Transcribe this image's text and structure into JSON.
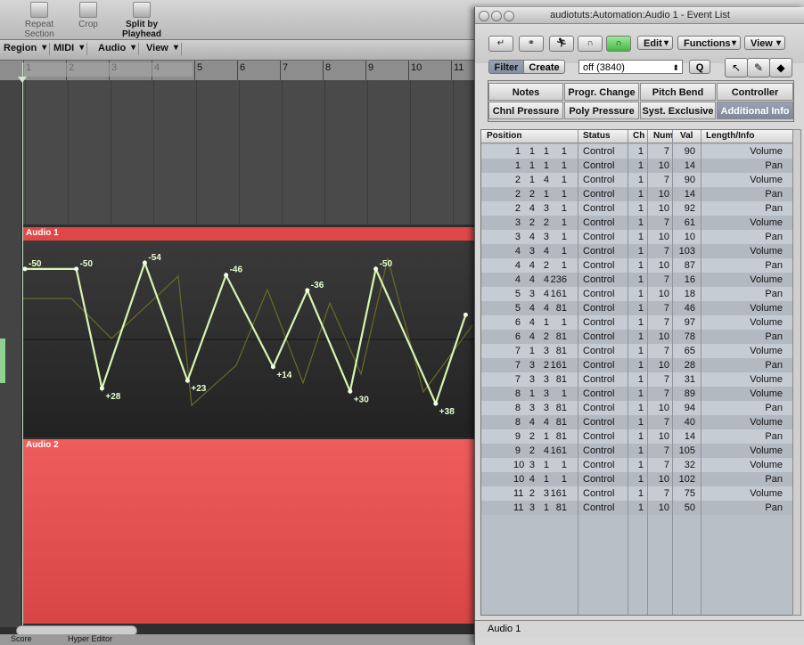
{
  "toolbar": {
    "repeat_section": "Repeat Section",
    "crop": "Crop",
    "split_by_playhead": "Split by Playhead"
  },
  "arrange_menu": [
    "Region",
    "MIDI",
    "Audio",
    "View"
  ],
  "ruler": [
    "1",
    "2",
    "3",
    "4",
    "5",
    "6",
    "7",
    "8",
    "9",
    "10",
    "11"
  ],
  "tracks": {
    "audio1": "Audio 1",
    "audio2": "Audio 2"
  },
  "automation": {
    "points": [
      {
        "time": 1.0,
        "value": -50
      },
      {
        "time": 2.2,
        "value": -50
      },
      {
        "time": 2.8,
        "value": 28
      },
      {
        "time": 3.8,
        "value": -54
      },
      {
        "time": 4.8,
        "value": 23
      },
      {
        "time": 5.7,
        "value": -46
      },
      {
        "time": 6.8,
        "value": 14
      },
      {
        "time": 7.6,
        "value": -36
      },
      {
        "time": 8.6,
        "value": 30
      },
      {
        "time": 9.2,
        "value": -50
      },
      {
        "time": 10.6,
        "value": 38
      },
      {
        "time": 11.3,
        "value": -20
      }
    ],
    "labels": [
      "-50",
      "-50",
      "+28",
      "-54",
      "+23",
      "-46",
      "+14",
      "-36",
      "+30",
      "-50",
      "+38"
    ]
  },
  "bottom_bar": {
    "score": "Score",
    "hyper_editor": "Hyper Editor"
  },
  "event_list": {
    "title": "audiotuts:Automation:Audio 1 - Event List",
    "menus": [
      "Edit",
      "Functions",
      "View"
    ],
    "filter": "Filter",
    "create": "Create",
    "type_select": "off (3840)",
    "q_button": "Q",
    "tabs_row1": [
      "Notes",
      "Progr. Change",
      "Pitch Bend",
      "Controller"
    ],
    "tabs_row2": [
      "Chnl Pressure",
      "Poly Pressure",
      "Syst. Exclusive",
      "Additional Info"
    ],
    "columns": [
      "Position",
      "Status",
      "Ch",
      "Num",
      "Val",
      "Length/Info"
    ],
    "rows": [
      [
        "1",
        "1",
        "1",
        "1",
        "Control",
        "1",
        "7",
        "90",
        "Volume"
      ],
      [
        "1",
        "1",
        "1",
        "1",
        "Control",
        "1",
        "10",
        "14",
        "Pan"
      ],
      [
        "2",
        "1",
        "4",
        "1",
        "Control",
        "1",
        "7",
        "90",
        "Volume"
      ],
      [
        "2",
        "2",
        "1",
        "1",
        "Control",
        "1",
        "10",
        "14",
        "Pan"
      ],
      [
        "2",
        "4",
        "3",
        "1",
        "Control",
        "1",
        "10",
        "92",
        "Pan"
      ],
      [
        "3",
        "2",
        "2",
        "1",
        "Control",
        "1",
        "7",
        "61",
        "Volume"
      ],
      [
        "3",
        "4",
        "3",
        "1",
        "Control",
        "1",
        "10",
        "10",
        "Pan"
      ],
      [
        "4",
        "3",
        "4",
        "1",
        "Control",
        "1",
        "7",
        "103",
        "Volume"
      ],
      [
        "4",
        "4",
        "2",
        "1",
        "Control",
        "1",
        "10",
        "87",
        "Pan"
      ],
      [
        "4",
        "4",
        "4",
        "236",
        "Control",
        "1",
        "7",
        "16",
        "Volume"
      ],
      [
        "5",
        "3",
        "4",
        "161",
        "Control",
        "1",
        "10",
        "18",
        "Pan"
      ],
      [
        "5",
        "4",
        "4",
        "81",
        "Control",
        "1",
        "7",
        "46",
        "Volume"
      ],
      [
        "6",
        "4",
        "1",
        "1",
        "Control",
        "1",
        "7",
        "97",
        "Volume"
      ],
      [
        "6",
        "4",
        "2",
        "81",
        "Control",
        "1",
        "10",
        "78",
        "Pan"
      ],
      [
        "7",
        "1",
        "3",
        "81",
        "Control",
        "1",
        "7",
        "65",
        "Volume"
      ],
      [
        "7",
        "3",
        "2",
        "161",
        "Control",
        "1",
        "10",
        "28",
        "Pan"
      ],
      [
        "7",
        "3",
        "3",
        "81",
        "Control",
        "1",
        "7",
        "31",
        "Volume"
      ],
      [
        "8",
        "1",
        "3",
        "1",
        "Control",
        "1",
        "7",
        "89",
        "Volume"
      ],
      [
        "8",
        "3",
        "3",
        "81",
        "Control",
        "1",
        "10",
        "94",
        "Pan"
      ],
      [
        "8",
        "4",
        "4",
        "81",
        "Control",
        "1",
        "7",
        "40",
        "Volume"
      ],
      [
        "9",
        "2",
        "1",
        "81",
        "Control",
        "1",
        "10",
        "14",
        "Pan"
      ],
      [
        "9",
        "2",
        "4",
        "161",
        "Control",
        "1",
        "7",
        "105",
        "Volume"
      ],
      [
        "10",
        "3",
        "1",
        "1",
        "Control",
        "1",
        "7",
        "32",
        "Volume"
      ],
      [
        "10",
        "4",
        "1",
        "1",
        "Control",
        "1",
        "10",
        "102",
        "Pan"
      ],
      [
        "11",
        "2",
        "3",
        "161",
        "Control",
        "1",
        "7",
        "75",
        "Volume"
      ],
      [
        "11",
        "3",
        "1",
        "81",
        "Control",
        "1",
        "10",
        "50",
        "Pan"
      ]
    ],
    "status": "Audio 1"
  },
  "colors": {
    "region_red": "#e04848",
    "automation_line": "#d8f5b0",
    "active_tab": "#7f889a",
    "green_button": "#44b844"
  }
}
